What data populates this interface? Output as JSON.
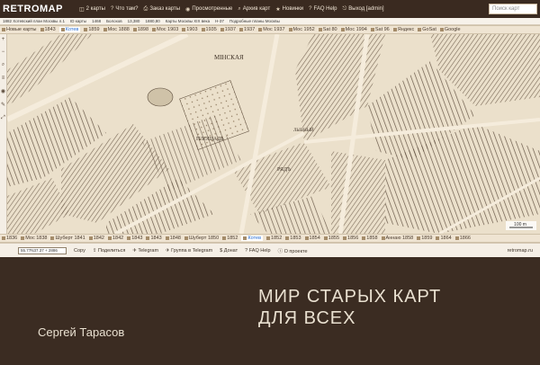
{
  "app": {
    "logo": "RETROMAP"
  },
  "nav": [
    {
      "icon": "two-maps-icon",
      "label": "2 карты"
    },
    {
      "icon": "question-icon",
      "label": "Что там?"
    },
    {
      "icon": "print-icon",
      "label": "Заказ карты"
    },
    {
      "icon": "eye-icon",
      "label": "Просмотренные"
    },
    {
      "icon": "search-icon",
      "label": "Архив карт"
    },
    {
      "icon": "news-icon",
      "label": "Новинки"
    },
    {
      "icon": "question-icon",
      "label": "FAQ Help"
    },
    {
      "icon": "exit-icon",
      "label": "Выход [admin]"
    }
  ],
  "search": {
    "placeholder": "Поиск карт"
  },
  "subbar": [
    "1882 Хотевский план Москвы л.1",
    "ID карты",
    "1468",
    "Болохов",
    "13,380",
    "1880,80",
    "Карты Москвы XIX века",
    "Н-37",
    "Подробные планы Москвы"
  ],
  "timeline_top": [
    "Новые карты",
    "1843",
    "Котев",
    "1859",
    "Мос 1888",
    "1898",
    "Мос 1903",
    "1903",
    "1935",
    "1937",
    "1937",
    "Мос 1937",
    "Мос 1952",
    "Sat 80",
    "Мос 1994",
    "Sat 96",
    "Яндекс",
    "GoSat",
    "Google"
  ],
  "timeline_bottom": [
    "1836",
    "Мос 1838",
    "Шуберт 1841",
    "1842",
    "1842",
    "1843",
    "1843",
    "1848",
    "Шуберт 1850",
    "1852",
    "Котев",
    "1852",
    "1853",
    "1854",
    "1855",
    "1856",
    "1858",
    "Аннаю 1858",
    "1859",
    "1864",
    "1866"
  ],
  "map_labels": {
    "square": "МIНСКАЯ",
    "ploshad": "ПЛОЩАДЬ",
    "ryad": "РЯДЪ",
    "lyv": "ЛЫВНЫЙ",
    "scale": "100 m"
  },
  "status": {
    "coords": "55.77N37.37 + 2886",
    "copy": "Copy",
    "share": "Поделиться",
    "telegram": "Telegram",
    "group": "Группа в Telegram",
    "donate": "Донат",
    "faq": "FAQ Help",
    "about": "О проекте",
    "site": "retromap.ru"
  },
  "headline": {
    "line1": "МИР СТАРЫХ КАРТ",
    "line2": "ДЛЯ ВСЕХ"
  },
  "author": "Сергей Тарасов"
}
